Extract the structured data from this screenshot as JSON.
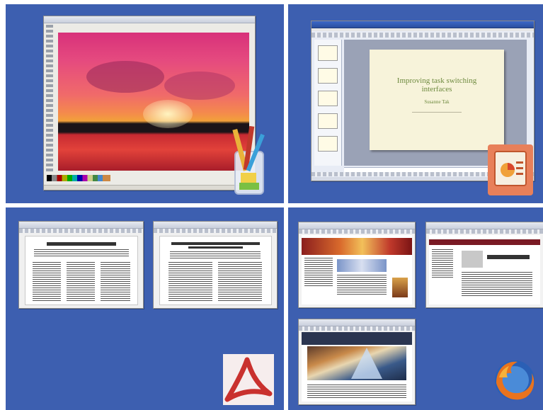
{
  "screen": {
    "description_colors": {
      "background": "#3d5fb0",
      "divider": "#ffffff"
    }
  },
  "groups": [
    {
      "id": "paint",
      "app_icon": "paint-brushes-icon",
      "windows": [
        "paint-window"
      ]
    },
    {
      "id": "powerpoint",
      "app_icon": "powerpoint-icon",
      "windows": [
        "powerpoint-window"
      ]
    },
    {
      "id": "acrobat",
      "app_icon": "acrobat-icon",
      "windows": [
        "pdf-window-1",
        "pdf-window-2"
      ]
    },
    {
      "id": "firefox",
      "app_icon": "firefox-icon",
      "windows": [
        "firefox-window-1",
        "firefox-window-2",
        "firefox-window-3"
      ]
    }
  ],
  "powerpoint": {
    "slide_title": "Improving task switching interfaces",
    "slide_author": "Susanne Tak"
  },
  "colors": {
    "accent_highlight": "#e8805a",
    "slide_bg": "#f7f3da",
    "slide_title": "#6e8a3f"
  }
}
